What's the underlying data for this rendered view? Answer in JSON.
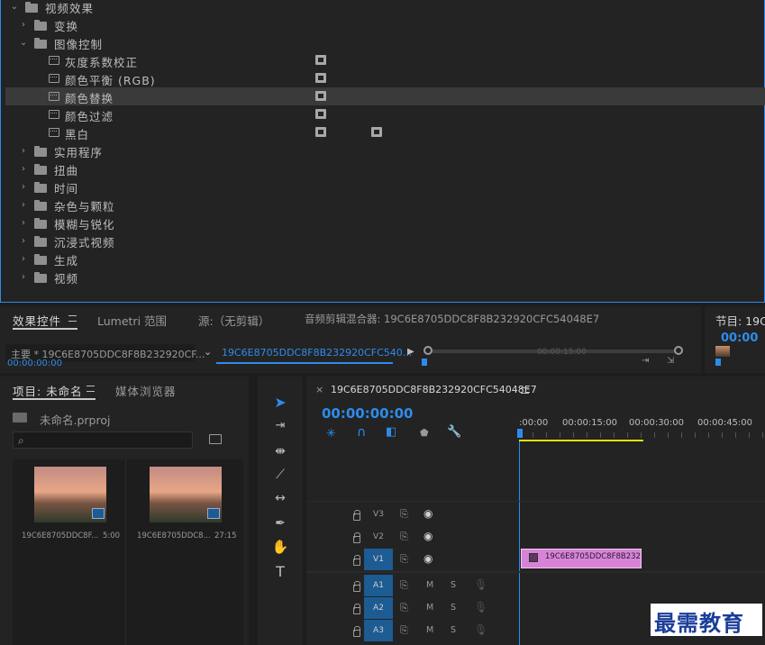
{
  "effects_tree": {
    "root": "视频效果",
    "groups_top": [
      {
        "label": "变换"
      }
    ],
    "open_group": "图像控制",
    "items": [
      {
        "label": "灰度系数校正"
      },
      {
        "label": "颜色平衡 (RGB)"
      },
      {
        "label": "颜色替换"
      },
      {
        "label": "颜色过滤"
      },
      {
        "label": "黑白"
      }
    ],
    "groups_bottom": [
      {
        "label": "实用程序"
      },
      {
        "label": "扭曲"
      },
      {
        "label": "时间"
      },
      {
        "label": "杂色与颗粒"
      },
      {
        "label": "模糊与锐化"
      },
      {
        "label": "沉浸式视频"
      },
      {
        "label": "生成"
      },
      {
        "label": "视频"
      }
    ]
  },
  "effect_controls": {
    "tab_effects": "效果控件",
    "tab_lumetri": "Lumetri 范围",
    "tab_source": "源:（无剪辑）",
    "tab_mixer": "音频剪辑混合器: 19C6E8705DDC8F8B232920CFC54048E7",
    "master_label": "主要 * 19C6E8705DDC8F8B232920CF...",
    "clip_label": "19C6E8705DDC8F8B232920CFC540...",
    "timecode": "00:00:00:00",
    "ruler_mark": "00:00:15:00"
  },
  "program": {
    "title": "节目: 19C6",
    "timecode": "00:00"
  },
  "project": {
    "tab_project": "项目: 未命名",
    "tab_media": "媒体浏览器",
    "file_name": "未命名.prproj",
    "search_placeholder": "",
    "clips": [
      {
        "name": "19C6E8705DDC8F...",
        "duration": "5:00"
      },
      {
        "name": "19C6E8705DDC8...",
        "duration": "27:15"
      }
    ]
  },
  "timeline": {
    "sequence_name": "19C6E8705DDC8F8B232920CFC54048E7",
    "timecode": "00:00:00:00",
    "ruler": [
      ":00:00",
      "00:00:15:00",
      "00:00:30:00",
      "00:00:45:00"
    ],
    "video_tracks": [
      "V3",
      "V2",
      "V1"
    ],
    "audio_tracks": [
      "A1",
      "A2",
      "A3"
    ],
    "mute": "M",
    "solo": "S",
    "clip_label": "19C6E8705DDC8F8B232"
  },
  "watermark": "最需教育",
  "colors": {
    "accent": "#2d8ceb",
    "clip": "#d783d8",
    "playhead": "#2d8ceb",
    "work_area": "#e3e000"
  }
}
